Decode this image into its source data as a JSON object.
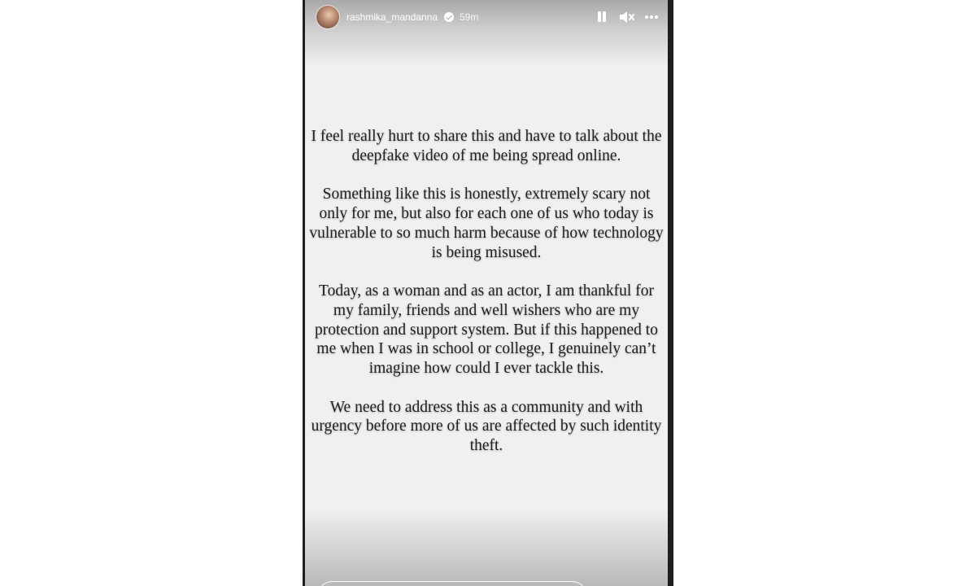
{
  "story": {
    "username": "rashmika_mandanna",
    "time": "59m",
    "verified": true,
    "icons": {
      "pause": "pause-icon",
      "mute": "muted-speaker-icon",
      "more": "more-horizontal-icon",
      "verified": "verified-badge-icon"
    },
    "paragraphs": [
      "I feel really hurt to share this and have to talk about the deepfake video of me being spread online.",
      "Something like this is honestly, extremely scary not only for me, but also for each one of us who today is vulnerable to so much harm because of how technology is being misused.",
      "Today, as a woman and as an actor, I am thankful for my family, friends and well wishers who are my protection and support system. But if this happened to me when I was in school or college, I genuinely can’t imagine how could I ever tackle this.",
      "We need to address this as a community and with urgency before more of us are affected by such identity theft."
    ]
  },
  "colors": {
    "page_background": "#ffffff",
    "phone_frame": "#1e1e1e",
    "story_background": "#f0f0f0",
    "text": "#222222",
    "header_text": "#ffffff"
  }
}
